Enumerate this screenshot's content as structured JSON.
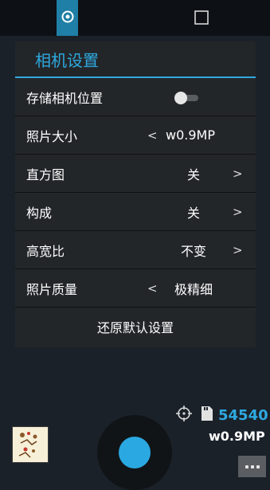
{
  "topbar": {
    "active_icon": "camera-mode-icon",
    "right_icon": "square-icon"
  },
  "panel": {
    "title": "相机设置",
    "rows": [
      {
        "label": "存储相机位置",
        "control": "toggle",
        "toggle_state": "off"
      },
      {
        "label": "照片大小",
        "value": "w0.9MP",
        "left_arrow": "<",
        "right_arrow": ""
      },
      {
        "label": "直方图",
        "value": "关",
        "left_arrow": "",
        "right_arrow": ">"
      },
      {
        "label": "构成",
        "value": "关",
        "left_arrow": "",
        "right_arrow": ">"
      },
      {
        "label": "高宽比",
        "value": "不变",
        "left_arrow": "",
        "right_arrow": ">"
      },
      {
        "label": "照片质量",
        "value": "极精细",
        "left_arrow": "<",
        "right_arrow": ""
      }
    ],
    "reset_label": "还原默认设置"
  },
  "status": {
    "remaining_count": "54540",
    "photo_size": "w0.9MP"
  },
  "colors": {
    "accent": "#2ea9e0",
    "panel_bg": "#232629",
    "page_bg": "#1b2129"
  }
}
